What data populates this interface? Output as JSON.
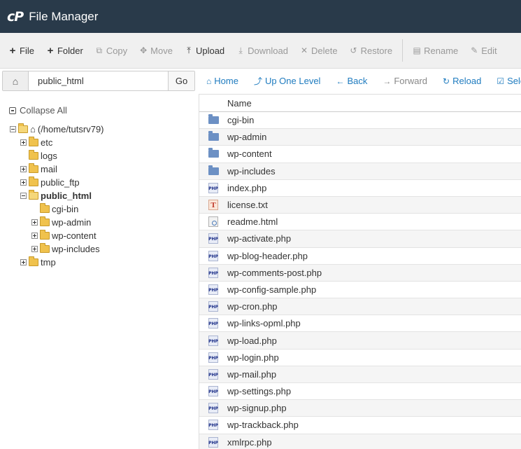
{
  "header": {
    "logo": "cP",
    "title": "File Manager"
  },
  "toolbar": {
    "items": [
      {
        "label": "File",
        "icon": "+",
        "disabled": false
      },
      {
        "label": "Folder",
        "icon": "+",
        "disabled": false
      },
      {
        "label": "Copy",
        "icon": "⧉",
        "disabled": true
      },
      {
        "label": "Move",
        "icon": "✥",
        "disabled": true
      },
      {
        "label": "Upload",
        "icon": "⤒",
        "disabled": false
      },
      {
        "label": "Download",
        "icon": "⤓",
        "disabled": true
      },
      {
        "label": "Delete",
        "icon": "✕",
        "disabled": true
      },
      {
        "label": "Restore",
        "icon": "↺",
        "disabled": true
      },
      {
        "label": "Rename",
        "icon": "▤",
        "disabled": true
      },
      {
        "label": "Edit",
        "icon": "✎",
        "disabled": true
      }
    ]
  },
  "pathbar": {
    "value": "public_html",
    "go_label": "Go"
  },
  "nav": {
    "home": "Home",
    "up": "Up One Level",
    "back": "Back",
    "forward": "Forward",
    "reload": "Reload",
    "select": "Select"
  },
  "tree": {
    "collapse_label": "Collapse All",
    "root_label": "(/home/tutsrv79)",
    "etc": "etc",
    "logs": "logs",
    "mail": "mail",
    "public_ftp": "public_ftp",
    "public_html": "public_html",
    "cgi_bin": "cgi-bin",
    "wp_admin": "wp-admin",
    "wp_content": "wp-content",
    "wp_includes": "wp-includes",
    "tmp": "tmp"
  },
  "table": {
    "column_name": "Name",
    "rows": [
      {
        "name": "cgi-bin",
        "type": "folder"
      },
      {
        "name": "wp-admin",
        "type": "folder"
      },
      {
        "name": "wp-content",
        "type": "folder"
      },
      {
        "name": "wp-includes",
        "type": "folder"
      },
      {
        "name": "index.php",
        "type": "php"
      },
      {
        "name": "license.txt",
        "type": "txt"
      },
      {
        "name": "readme.html",
        "type": "html"
      },
      {
        "name": "wp-activate.php",
        "type": "php"
      },
      {
        "name": "wp-blog-header.php",
        "type": "php"
      },
      {
        "name": "wp-comments-post.php",
        "type": "php"
      },
      {
        "name": "wp-config-sample.php",
        "type": "php"
      },
      {
        "name": "wp-cron.php",
        "type": "php"
      },
      {
        "name": "wp-links-opml.php",
        "type": "php"
      },
      {
        "name": "wp-load.php",
        "type": "php"
      },
      {
        "name": "wp-login.php",
        "type": "php"
      },
      {
        "name": "wp-mail.php",
        "type": "php"
      },
      {
        "name": "wp-settings.php",
        "type": "php"
      },
      {
        "name": "wp-signup.php",
        "type": "php"
      },
      {
        "name": "wp-trackback.php",
        "type": "php"
      },
      {
        "name": "xmlrpc.php",
        "type": "php"
      }
    ]
  }
}
